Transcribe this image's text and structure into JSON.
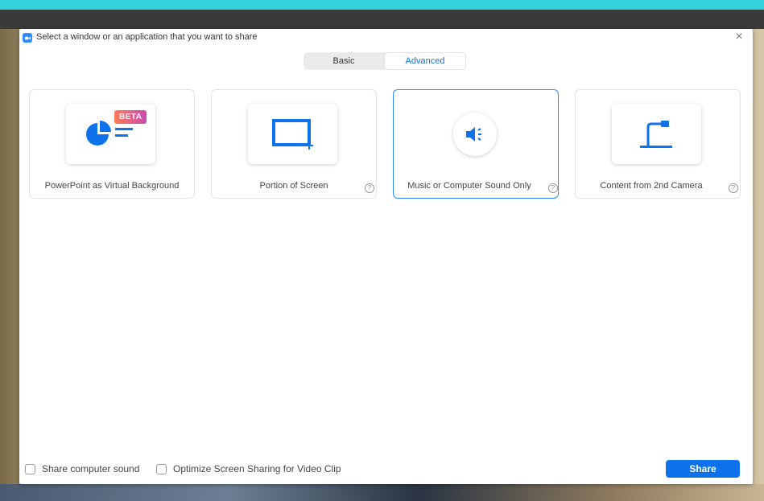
{
  "dialog": {
    "title": "Select a window or an application that you want to share",
    "close_symbol": "×"
  },
  "tabs": [
    {
      "label": "Basic",
      "active": false
    },
    {
      "label": "Advanced",
      "active": true
    }
  ],
  "options": [
    {
      "label": "PowerPoint as Virtual Background",
      "badge": "BETA",
      "icon": "powerpoint-background-icon",
      "help": false,
      "selected": false
    },
    {
      "label": "Portion of Screen",
      "icon": "screen-portion-icon",
      "help": true,
      "selected": false
    },
    {
      "label": "Music or Computer Sound Only",
      "icon": "speaker-icon",
      "help": true,
      "selected": true
    },
    {
      "label": "Content from 2nd Camera",
      "icon": "document-camera-icon",
      "help": true,
      "selected": false
    }
  ],
  "help_symbol": "?",
  "footer": {
    "share_sound_label": "Share computer sound",
    "optimize_label": "Optimize Screen Sharing for Video Clip",
    "share_button": "Share"
  },
  "colors": {
    "accent": "#0e72ed",
    "icon_blue": "#2d8cff",
    "top_stripe": "#33d1dc"
  }
}
